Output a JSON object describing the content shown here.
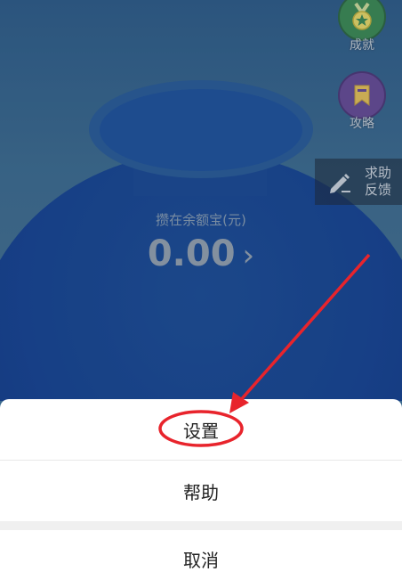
{
  "badges": {
    "achievement_label": "成就",
    "strategy_label": "攻略"
  },
  "help_feedback": {
    "line1": "求助",
    "line2": "反馈"
  },
  "balance": {
    "label": "攒在余额宝(元)",
    "amount": "0.00",
    "arrow": "›"
  },
  "action_sheet": {
    "settings_label": "设置",
    "help_label": "帮助",
    "cancel_label": "取消"
  },
  "colors": {
    "annotation": "#e8242c",
    "pot": "#164596",
    "sheet_background": "#ffffff"
  },
  "icons": {
    "achievement": "medal-icon",
    "strategy": "bookmark-icon",
    "feedback": "pencil-icon",
    "balance_arrow": "chevron-right-icon"
  }
}
